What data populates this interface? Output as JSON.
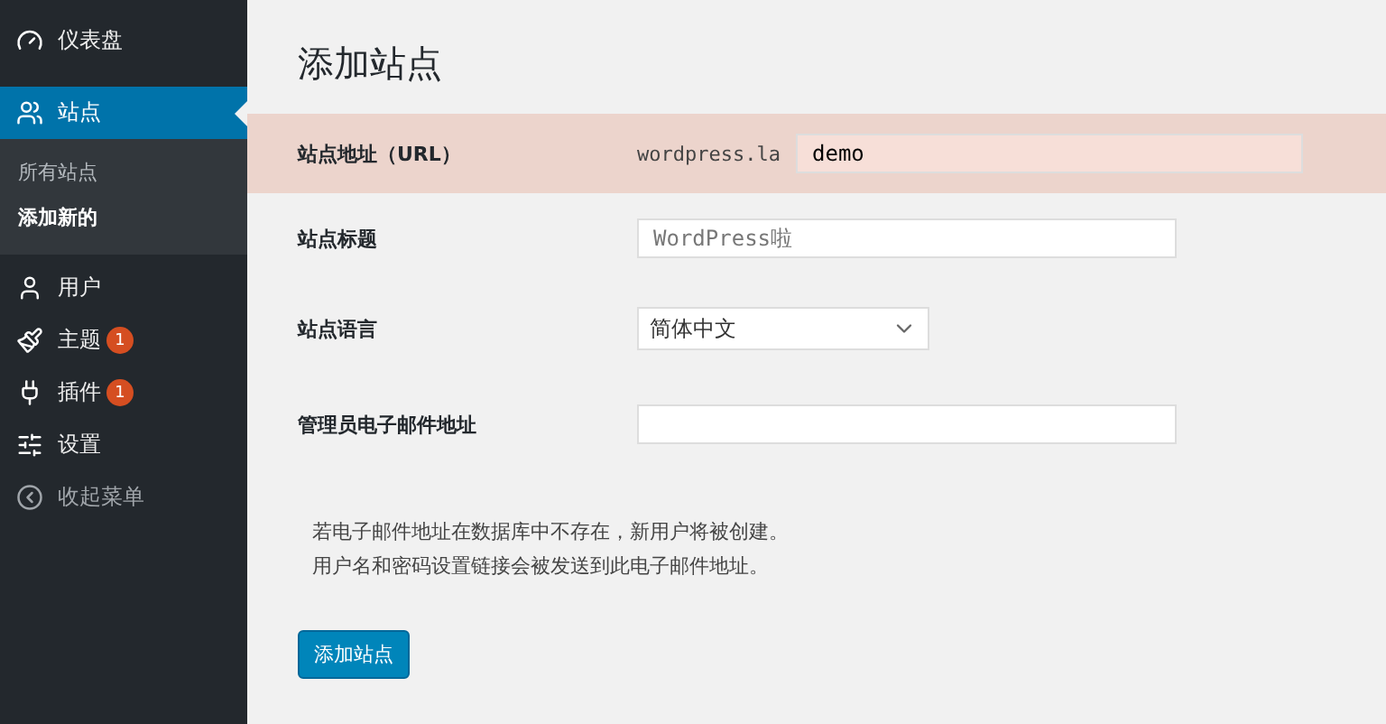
{
  "sidebar": {
    "items": [
      {
        "label": "仪表盘",
        "selected": false
      },
      {
        "label": "站点",
        "selected": true,
        "children": [
          {
            "label": "所有站点",
            "selected": false
          },
          {
            "label": "添加新的",
            "selected": true
          }
        ]
      },
      {
        "label": "用户",
        "selected": false
      },
      {
        "label": "主题",
        "selected": false,
        "badge": "1"
      },
      {
        "label": "插件",
        "selected": false,
        "badge": "1"
      },
      {
        "label": "设置",
        "selected": false
      },
      {
        "label": "收起菜单",
        "selected": false,
        "kind": "collapse"
      }
    ]
  },
  "page": {
    "title": "添加站点",
    "fields": [
      {
        "kind": "url",
        "label": "站点地址（URL）",
        "prefix": "wordpress.la",
        "value": "demo",
        "highlighted": true
      },
      {
        "kind": "text",
        "label": "站点标题",
        "placeholder": "WordPress啦",
        "highlighted": false
      },
      {
        "kind": "select",
        "label": "站点语言",
        "value": "简体中文",
        "highlighted": false
      },
      {
        "kind": "email",
        "label": "管理员电子邮件地址",
        "highlighted": false
      }
    ],
    "description": [
      "若电子邮件地址在数据库中不存在，新用户将被创建。",
      "用户名和密码设置链接会被发送到此电子邮件地址。"
    ],
    "submit": "添加站点"
  }
}
